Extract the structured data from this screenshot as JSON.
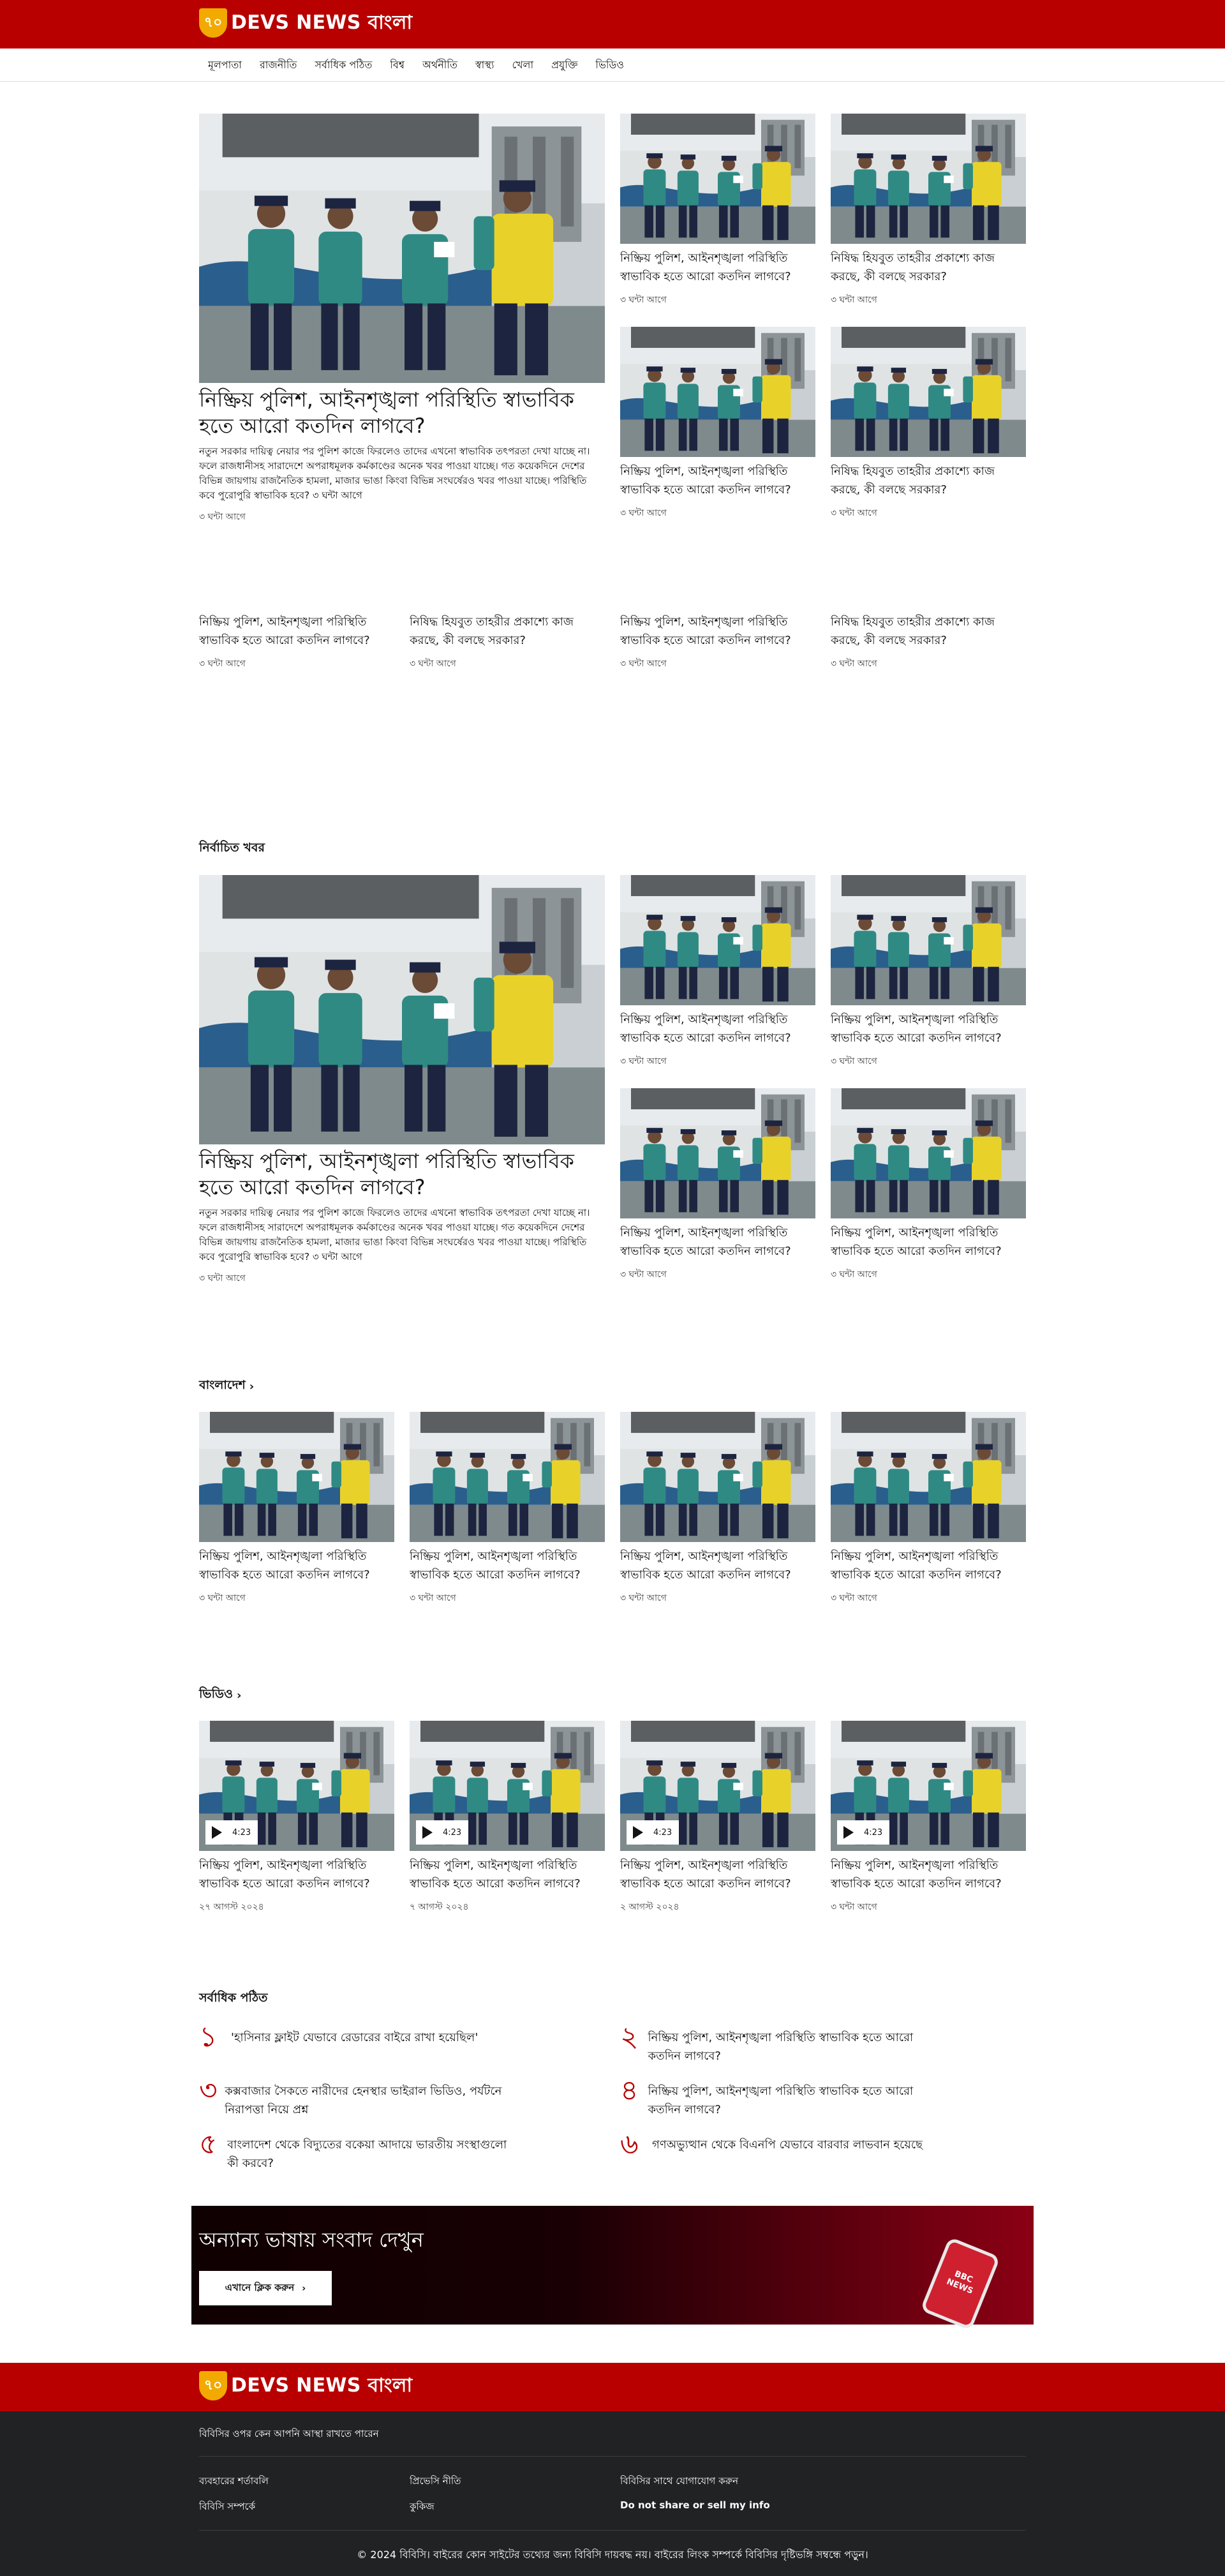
{
  "brand": {
    "badge": "৭০",
    "name": "DEVS NEWS বাংলা"
  },
  "nav": [
    "মূলপাতা",
    "রাজনীতি",
    "সর্বাধিক পঠিত",
    "বিশ্ব",
    "অর্থনীতি",
    "স্বাস্থ্য",
    "খেলা",
    "প্রযুক্তি",
    "ভিডিও"
  ],
  "top": {
    "lead": {
      "title": "নিষ্ক্রিয় পুলিশ, আইনশৃঙ্খলা পরিস্থিতি স্বাভাবিক হতে আরো কতদিন লাগবে?",
      "summary": "নতুন সরকার দায়িত্ব নেয়ার পর পুলিশ কাজে ফিরলেও তাদের এখনো স্বাভাবিক তৎপরতা দেখা যাচ্ছে না। ফলে রাজধানীসহ সারাদেশে অপরাধমূলক কর্মকাণ্ডের অনেক খবর পাওয়া যাচ্ছে। গত কয়েকদিনে দেশের বিভিন্ন জায়গায় রাজনৈতিক হামলা, মাজার ভাঙা কিংবা বিভিন্ন সংঘর্ষেরও খবর পাওয়া যাচ্ছে। পরিস্থিতি কবে পুরোপুরি স্বাভাবিক হবে? ৩ ঘন্টা আগে",
      "time": "৩ ঘন্টা আগে"
    },
    "side": [
      {
        "title": "নিষ্ক্রিয় পুলিশ, আইনশৃঙ্খলা পরিস্থিতি স্বাভাবিক হতে আরো কতদিন লাগবে?",
        "time": "৩ ঘন্টা আগে"
      },
      {
        "title": "নিষিদ্ধ হিযবুত তাহরীর প্রকাশ্যে কাজ করছে, কী বলছে সরকার?",
        "time": "৩ ঘন্টা আগে"
      },
      {
        "title": "নিষ্ক্রিয় পুলিশ, আইনশৃঙ্খলা পরিস্থিতি স্বাভাবিক হতে আরো কতদিন লাগবে?",
        "time": "৩ ঘন্টা আগে"
      },
      {
        "title": "নিষিদ্ধ হিযবুত তাহরীর প্রকাশ্যে কাজ করছে, কী বলছে সরকার?",
        "time": "৩ ঘন্টা আগে"
      }
    ],
    "textrow": [
      {
        "title": "নিষ্ক্রিয় পুলিশ, আইনশৃঙ্খলা পরিস্থিতি স্বাভাবিক হতে আরো কতদিন লাগবে?",
        "time": "৩ ঘন্টা আগে"
      },
      {
        "title": "নিষিদ্ধ হিযবুত তাহরীর প্রকাশ্যে কাজ করছে, কী বলছে সরকার?",
        "time": "৩ ঘন্টা আগে"
      },
      {
        "title": "নিষ্ক্রিয় পুলিশ, আইনশৃঙ্খলা পরিস্থিতি স্বাভাবিক হতে আরো কতদিন লাগবে?",
        "time": "৩ ঘন্টা আগে"
      },
      {
        "title": "নিষিদ্ধ হিযবুত তাহরীর প্রকাশ্যে কাজ করছে, কী বলছে সরকার?",
        "time": "৩ ঘন্টা আগে"
      }
    ]
  },
  "selected": {
    "heading": "নির্বাচিত খবর",
    "lead": {
      "title": "নিষ্ক্রিয় পুলিশ, আইনশৃঙ্খলা পরিস্থিতি স্বাভাবিক হতে আরো কতদিন লাগবে?",
      "summary": "নতুন সরকার দায়িত্ব নেয়ার পর পুলিশ কাজে ফিরলেও তাদের এখনো স্বাভাবিক তৎপরতা দেখা যাচ্ছে না। ফলে রাজধানীসহ সারাদেশে অপরাধমূলক কর্মকাণ্ডের অনেক খবর পাওয়া যাচ্ছে। গত কয়েকদিনে দেশের বিভিন্ন জায়গায় রাজনৈতিক হামলা, মাজার ভাঙা কিংবা বিভিন্ন সংঘর্ষেরও খবর পাওয়া যাচ্ছে। পরিস্থিতি কবে পুরোপুরি স্বাভাবিক হবে? ৩ ঘন্টা আগে",
      "time": "৩ ঘন্টা আগে"
    },
    "side": [
      {
        "title": "নিষ্ক্রিয় পুলিশ, আইনশৃঙ্খলা পরিস্থিতি স্বাভাবিক হতে আরো কতদিন লাগবে?",
        "time": "৩ ঘন্টা আগে"
      },
      {
        "title": "নিষ্ক্রিয় পুলিশ, আইনশৃঙ্খলা পরিস্থিতি স্বাভাবিক হতে আরো কতদিন লাগবে?",
        "time": "৩ ঘন্টা আগে"
      },
      {
        "title": "নিষ্ক্রিয় পুলিশ, আইনশৃঙ্খলা পরিস্থিতি স্বাভাবিক হতে আরো কতদিন লাগবে?",
        "time": "৩ ঘন্টা আগে"
      },
      {
        "title": "নিষ্ক্রিয় পুলিশ, আইনশৃঙ্খলা পরিস্থিতি স্বাভাবিক হতে আরো কতদিন লাগবে?",
        "time": "৩ ঘন্টা আগে"
      }
    ]
  },
  "bangladesh": {
    "heading": "বাংলাদেশ",
    "items": [
      {
        "title": "নিষ্ক্রিয় পুলিশ, আইনশৃঙ্খলা পরিস্থিতি স্বাভাবিক হতে আরো কতদিন লাগবে?",
        "time": "৩ ঘন্টা আগে"
      },
      {
        "title": "নিষ্ক্রিয় পুলিশ, আইনশৃঙ্খলা পরিস্থিতি স্বাভাবিক হতে আরো কতদিন লাগবে?",
        "time": "৩ ঘন্টা আগে"
      },
      {
        "title": "নিষ্ক্রিয় পুলিশ, আইনশৃঙ্খলা পরিস্থিতি স্বাভাবিক হতে আরো কতদিন লাগবে?",
        "time": "৩ ঘন্টা আগে"
      },
      {
        "title": "নিষ্ক্রিয় পুলিশ, আইনশৃঙ্খলা পরিস্থিতি স্বাভাবিক হতে আরো কতদিন লাগবে?",
        "time": "৩ ঘন্টা আগে"
      }
    ]
  },
  "video": {
    "heading": "ভিডিও",
    "items": [
      {
        "title": "নিষ্ক্রিয় পুলিশ, আইনশৃঙ্খলা পরিস্থিতি স্বাভাবিক হতে আরো কতদিন লাগবে?",
        "time": "২৭ আগস্ট ২০২৪",
        "duration": "4:23"
      },
      {
        "title": "নিষ্ক্রিয় পুলিশ, আইনশৃঙ্খলা পরিস্থিতি স্বাভাবিক হতে আরো কতদিন লাগবে?",
        "time": "৭ আগস্ট ২০২৪",
        "duration": "4:23"
      },
      {
        "title": "নিষ্ক্রিয় পুলিশ, আইনশৃঙ্খলা পরিস্থিতি স্বাভাবিক হতে আরো কতদিন লাগবে?",
        "time": "২ আগস্ট ২০২৪",
        "duration": "4:23"
      },
      {
        "title": "নিষ্ক্রিয় পুলিশ, আইনশৃঙ্খলা পরিস্থিতি স্বাভাবিক হতে আরো কতদিন লাগবে?",
        "time": "৩ ঘন্টা আগে",
        "duration": "4:23"
      }
    ]
  },
  "most_read": {
    "heading": "সর্বাধিক পঠিত",
    "items": [
      {
        "num": "১",
        "title": "'হাসিনার ফ্লাইট যেভাবে রেডারের বাইরে রাখা হয়েছিল'"
      },
      {
        "num": "২",
        "title": "নিষ্ক্রিয় পুলিশ, আইনশৃঙ্খলা পরিস্থিতি স্বাভাবিক হতে আরো কতদিন লাগবে?"
      },
      {
        "num": "৩",
        "title": "কক্সবাজার সৈকতে নারীদের হেনস্থার ভাইরাল ভিডিও, পর্যটনে নিরাপত্তা নিয়ে প্রশ্ন"
      },
      {
        "num": "৪",
        "title": "নিষ্ক্রিয় পুলিশ, আইনশৃঙ্খলা পরিস্থিতি স্বাভাবিক হতে আরো কতদিন লাগবে?"
      },
      {
        "num": "৫",
        "title": "বাংলাদেশ থেকে বিদ্যুতের বকেয়া আদায়ে ভারতীয় সংস্থাগুলো কী করবে?"
      },
      {
        "num": "৬",
        "title": "গণঅভ্যুত্থান থেকে বিএনপি যেভাবে বারবার লাভবান হয়েছে"
      }
    ]
  },
  "banner": {
    "title": "অন্যান্য ভাষায় সংবাদ দেখুন",
    "button": "এখানে ক্লিক করুন",
    "phone_text": "BBC NEWS"
  },
  "footer": {
    "question": "বিবিসির ওপর কেন আপনি আস্থা রাখতে পারেন",
    "links": [
      "ব্যবহারের শর্তাবলি",
      "প্রিভেসি নীতি",
      "বিবিসির সাথে যোগাযোগ করুন",
      "বিবিসি সম্পর্কে",
      "কুকিজ",
      "Do not share or sell my info"
    ],
    "copyright": "© 2024 বিবিসি। বাইরের কোন সাইটের তথ্যের জন্য বিবিসি দায়বদ্ধ নয়। বাইরের লিংক সম্পর্কে বিবিসির দৃষ্টিভঙ্গি সম্বন্ধে পড়ুন।"
  },
  "colors": {
    "brand_red": "#b80000",
    "logo_gold": "#f2a900",
    "footer_dark": "#202224"
  }
}
